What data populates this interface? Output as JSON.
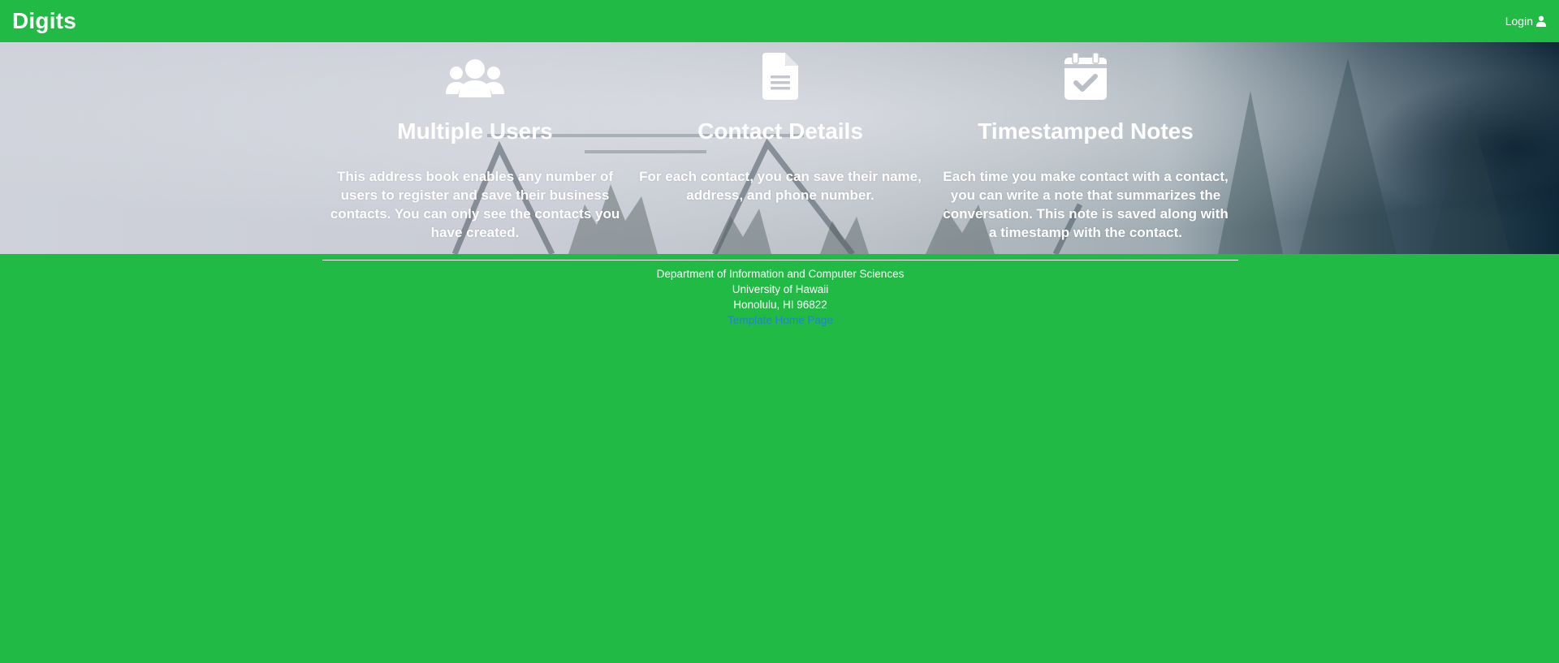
{
  "navbar": {
    "brand": "Digits",
    "login_label": "Login",
    "login_icon": "user-icon"
  },
  "features": [
    {
      "icon": "users-icon",
      "title": "Multiple Users",
      "text": "This address book enables any number of users to register and save their business contacts. You can only see the contacts you have created."
    },
    {
      "icon": "file-text-icon",
      "title": "Contact Details",
      "text": "For each contact, you can save their name, address, and phone number."
    },
    {
      "icon": "calendar-check-icon",
      "title": "Timestamped Notes",
      "text": "Each time you make contact with a contact, you can write a note that summarizes the conversation. This note is saved along with a timestamp with the contact."
    }
  ],
  "footer": {
    "line1": "Department of Information and Computer Sciences",
    "line2": "University of Hawaii",
    "line3": "Honolulu, HI 96822",
    "link_label": "Template Home Page"
  },
  "colors": {
    "background": "#21ba45",
    "text": "#ffffff",
    "link": "#2185d0"
  }
}
